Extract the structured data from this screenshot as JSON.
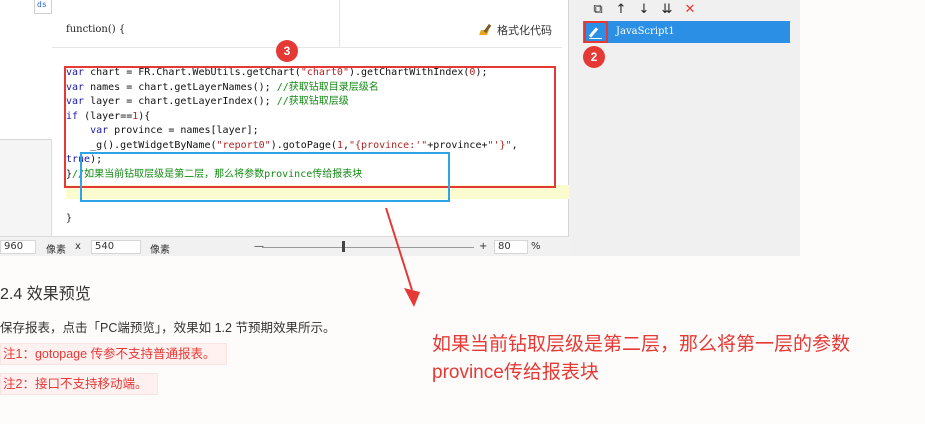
{
  "editor": {
    "function_header": "function() {",
    "format_button": "格式化代码",
    "closing_brace": "}",
    "code_lines": [
      {
        "parts": [
          [
            "kw",
            "var"
          ],
          [
            "fn",
            " chart = FR.Chart.WebUtils.getChart("
          ],
          [
            "str",
            "\"chart0\""
          ],
          [
            "fn",
            ").getChartWithIndex("
          ],
          [
            "str",
            "0"
          ],
          [
            "fn",
            ");"
          ]
        ]
      },
      {
        "parts": [
          [
            "kw",
            "var"
          ],
          [
            "fn",
            " names = chart.getLayerNames(); "
          ],
          [
            "cm",
            "//获取钻取目录层级名"
          ]
        ]
      },
      {
        "parts": [
          [
            "kw",
            "var"
          ],
          [
            "fn",
            " layer = chart.getLayerIndex(); "
          ],
          [
            "cm",
            "//获取钻取层级"
          ]
        ]
      },
      {
        "parts": [
          [
            "kw",
            "if"
          ],
          [
            "fn",
            " (layer=="
          ],
          [
            "str",
            "1"
          ],
          [
            "fn",
            "){"
          ]
        ]
      },
      {
        "parts": [
          [
            "kw",
            "    var"
          ],
          [
            "fn",
            " province = names[layer];"
          ]
        ]
      },
      {
        "parts": [
          [
            "fn",
            "    _g().getWidgetByName("
          ],
          [
            "str",
            "\"report0\""
          ],
          [
            "fn",
            ").gotoPage("
          ],
          [
            "str",
            "1"
          ],
          [
            "fn",
            ","
          ],
          [
            "str",
            "\"{province:'\""
          ],
          [
            "fn",
            "+province+"
          ],
          [
            "str",
            "\"'}\""
          ],
          [
            "fn",
            ","
          ]
        ]
      },
      {
        "parts": [
          [
            "kw",
            "true"
          ],
          [
            "fn",
            ");"
          ]
        ]
      },
      {
        "parts": [
          [
            "fn",
            "}"
          ],
          [
            "cm",
            "//如果当前钻取层级是第二层，那么将参数province传给报表块"
          ]
        ]
      }
    ]
  },
  "badges": {
    "three": "3",
    "two": "2"
  },
  "statusbar": {
    "width_value": "960",
    "width_unit": "像素",
    "times": "x",
    "height_value": "540",
    "height_unit": "像素",
    "minus": "—",
    "plus": "+",
    "zoom_value": "80",
    "percent": "%"
  },
  "right_panel": {
    "toolbar_icons": [
      "copy-icon",
      "arrow-up-icon",
      "arrow-down-icon",
      "sort-down-icon",
      "delete-icon"
    ],
    "toolbar_glyphs": [
      "⧉",
      "↑",
      "↓",
      "⇊",
      "✕"
    ],
    "script_item": "JavaScript1"
  },
  "thumb_label": "ds",
  "article": {
    "section_title": "2.4 效果预览",
    "paragraph": "保存报表，点击「PC端预览」，效果如 1.2 节预期效果所示。",
    "note1": "注1：gotopage 传参不支持普通报表。",
    "note2": "注2：接口不支持移动端。"
  },
  "annotation": {
    "line1": "如果当前钻取层级是第二层，那么将第一层的参数",
    "line2": "province传给报表块"
  },
  "colors": {
    "accent_red": "#e53935",
    "blue_box": "#2ea3e6",
    "selected_item": "#2c8fe6"
  }
}
